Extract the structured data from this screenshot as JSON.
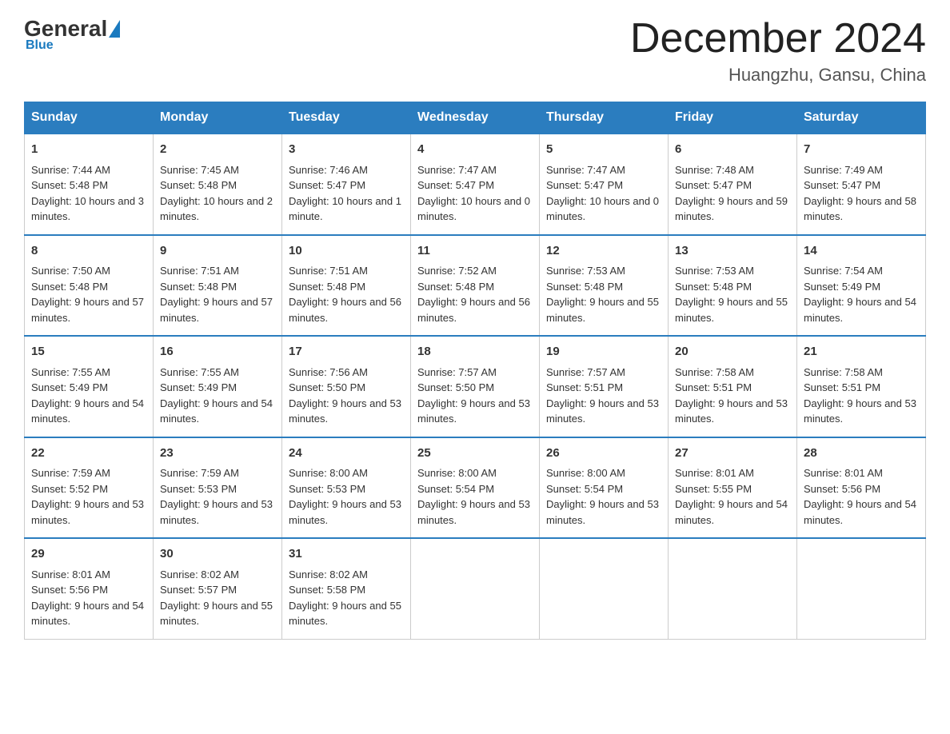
{
  "logo": {
    "general": "General",
    "blue": "Blue"
  },
  "title": "December 2024",
  "subtitle": "Huangzhu, Gansu, China",
  "days_header": [
    "Sunday",
    "Monday",
    "Tuesday",
    "Wednesday",
    "Thursday",
    "Friday",
    "Saturday"
  ],
  "weeks": [
    [
      {
        "num": "1",
        "sunrise": "7:44 AM",
        "sunset": "5:48 PM",
        "daylight": "10 hours and 3 minutes."
      },
      {
        "num": "2",
        "sunrise": "7:45 AM",
        "sunset": "5:48 PM",
        "daylight": "10 hours and 2 minutes."
      },
      {
        "num": "3",
        "sunrise": "7:46 AM",
        "sunset": "5:47 PM",
        "daylight": "10 hours and 1 minute."
      },
      {
        "num": "4",
        "sunrise": "7:47 AM",
        "sunset": "5:47 PM",
        "daylight": "10 hours and 0 minutes."
      },
      {
        "num": "5",
        "sunrise": "7:47 AM",
        "sunset": "5:47 PM",
        "daylight": "10 hours and 0 minutes."
      },
      {
        "num": "6",
        "sunrise": "7:48 AM",
        "sunset": "5:47 PM",
        "daylight": "9 hours and 59 minutes."
      },
      {
        "num": "7",
        "sunrise": "7:49 AM",
        "sunset": "5:47 PM",
        "daylight": "9 hours and 58 minutes."
      }
    ],
    [
      {
        "num": "8",
        "sunrise": "7:50 AM",
        "sunset": "5:48 PM",
        "daylight": "9 hours and 57 minutes."
      },
      {
        "num": "9",
        "sunrise": "7:51 AM",
        "sunset": "5:48 PM",
        "daylight": "9 hours and 57 minutes."
      },
      {
        "num": "10",
        "sunrise": "7:51 AM",
        "sunset": "5:48 PM",
        "daylight": "9 hours and 56 minutes."
      },
      {
        "num": "11",
        "sunrise": "7:52 AM",
        "sunset": "5:48 PM",
        "daylight": "9 hours and 56 minutes."
      },
      {
        "num": "12",
        "sunrise": "7:53 AM",
        "sunset": "5:48 PM",
        "daylight": "9 hours and 55 minutes."
      },
      {
        "num": "13",
        "sunrise": "7:53 AM",
        "sunset": "5:48 PM",
        "daylight": "9 hours and 55 minutes."
      },
      {
        "num": "14",
        "sunrise": "7:54 AM",
        "sunset": "5:49 PM",
        "daylight": "9 hours and 54 minutes."
      }
    ],
    [
      {
        "num": "15",
        "sunrise": "7:55 AM",
        "sunset": "5:49 PM",
        "daylight": "9 hours and 54 minutes."
      },
      {
        "num": "16",
        "sunrise": "7:55 AM",
        "sunset": "5:49 PM",
        "daylight": "9 hours and 54 minutes."
      },
      {
        "num": "17",
        "sunrise": "7:56 AM",
        "sunset": "5:50 PM",
        "daylight": "9 hours and 53 minutes."
      },
      {
        "num": "18",
        "sunrise": "7:57 AM",
        "sunset": "5:50 PM",
        "daylight": "9 hours and 53 minutes."
      },
      {
        "num": "19",
        "sunrise": "7:57 AM",
        "sunset": "5:51 PM",
        "daylight": "9 hours and 53 minutes."
      },
      {
        "num": "20",
        "sunrise": "7:58 AM",
        "sunset": "5:51 PM",
        "daylight": "9 hours and 53 minutes."
      },
      {
        "num": "21",
        "sunrise": "7:58 AM",
        "sunset": "5:51 PM",
        "daylight": "9 hours and 53 minutes."
      }
    ],
    [
      {
        "num": "22",
        "sunrise": "7:59 AM",
        "sunset": "5:52 PM",
        "daylight": "9 hours and 53 minutes."
      },
      {
        "num": "23",
        "sunrise": "7:59 AM",
        "sunset": "5:53 PM",
        "daylight": "9 hours and 53 minutes."
      },
      {
        "num": "24",
        "sunrise": "8:00 AM",
        "sunset": "5:53 PM",
        "daylight": "9 hours and 53 minutes."
      },
      {
        "num": "25",
        "sunrise": "8:00 AM",
        "sunset": "5:54 PM",
        "daylight": "9 hours and 53 minutes."
      },
      {
        "num": "26",
        "sunrise": "8:00 AM",
        "sunset": "5:54 PM",
        "daylight": "9 hours and 53 minutes."
      },
      {
        "num": "27",
        "sunrise": "8:01 AM",
        "sunset": "5:55 PM",
        "daylight": "9 hours and 54 minutes."
      },
      {
        "num": "28",
        "sunrise": "8:01 AM",
        "sunset": "5:56 PM",
        "daylight": "9 hours and 54 minutes."
      }
    ],
    [
      {
        "num": "29",
        "sunrise": "8:01 AM",
        "sunset": "5:56 PM",
        "daylight": "9 hours and 54 minutes."
      },
      {
        "num": "30",
        "sunrise": "8:02 AM",
        "sunset": "5:57 PM",
        "daylight": "9 hours and 55 minutes."
      },
      {
        "num": "31",
        "sunrise": "8:02 AM",
        "sunset": "5:58 PM",
        "daylight": "9 hours and 55 minutes."
      },
      null,
      null,
      null,
      null
    ]
  ],
  "labels": {
    "sunrise": "Sunrise:",
    "sunset": "Sunset:",
    "daylight": "Daylight:"
  }
}
